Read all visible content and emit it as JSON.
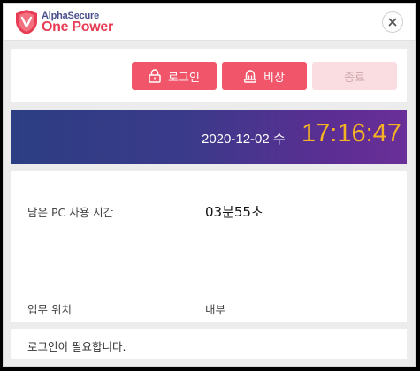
{
  "brand": {
    "company": "AlphaSecure",
    "product": "One Power"
  },
  "toolbar": {
    "login_label": "로그인",
    "emergency_label": "비상",
    "exit_label": "종료"
  },
  "clock": {
    "date": "2020-12-02 수",
    "time": "17:16:47"
  },
  "info": {
    "remaining_label": "남은 PC 사용 시간",
    "remaining_value": "03분55초",
    "location_label": "업무 위치",
    "location_value": "내부"
  },
  "status": {
    "message": "로그인이 필요합니다."
  },
  "icons": {
    "logo": "shield-logo-icon",
    "close": "close-icon",
    "login": "padlock-icon",
    "emergency": "siren-icon"
  },
  "colors": {
    "accent": "#f0556a",
    "accent_disabled": "#f9dde0",
    "clock": "#f5b324",
    "banner_start": "#2c3e83",
    "banner_end": "#6a2f98"
  }
}
